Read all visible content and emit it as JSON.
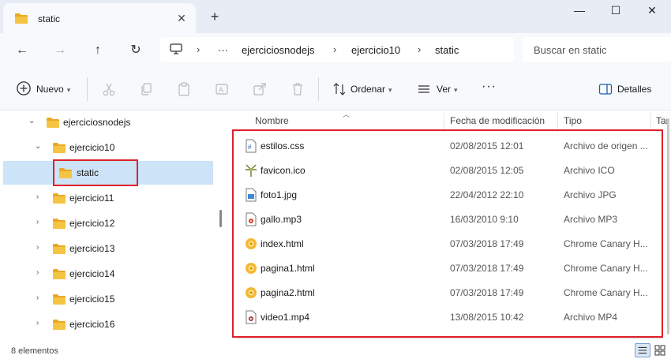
{
  "tab": {
    "title": "static",
    "close": "✕",
    "new": "+"
  },
  "window": {
    "minimize": "—",
    "maximize": "☐",
    "close": "✕"
  },
  "address": {
    "overflow": "···",
    "separator": "›",
    "crumbs": [
      "ejerciciosnodejs",
      "ejercicio10",
      "static"
    ],
    "search_placeholder": "Buscar en static"
  },
  "toolbar": {
    "new_label": "Nuevo",
    "sort_label": "Ordenar",
    "view_label": "Ver",
    "more_label": "···",
    "details_label": "Detalles"
  },
  "nav": {
    "items": [
      {
        "label": "ejerciciosnodejs",
        "expanded": true
      },
      {
        "label": "ejercicio10",
        "expanded": true
      },
      {
        "label": "static",
        "selected": true
      },
      {
        "label": "ejercicio11"
      },
      {
        "label": "ejercicio12"
      },
      {
        "label": "ejercicio13"
      },
      {
        "label": "ejercicio14"
      },
      {
        "label": "ejercicio15"
      },
      {
        "label": "ejercicio16"
      }
    ]
  },
  "columns": {
    "name": "Nombre",
    "date": "Fecha de modificación",
    "type": "Tipo",
    "size": "Tar"
  },
  "files": [
    {
      "name": "estilos.css",
      "date": "02/08/2015 12:01",
      "type": "Archivo de origen ...",
      "icon": "css-file-icon"
    },
    {
      "name": "favicon.ico",
      "date": "02/08/2015 12:05",
      "type": "Archivo ICO",
      "icon": "ico-file-icon"
    },
    {
      "name": "foto1.jpg",
      "date": "22/04/2012 22:10",
      "type": "Archivo JPG",
      "icon": "image-file-icon"
    },
    {
      "name": "gallo.mp3",
      "date": "16/03/2010 9:10",
      "type": "Archivo MP3",
      "icon": "audio-file-icon"
    },
    {
      "name": "index.html",
      "date": "07/03/2018 17:49",
      "type": "Chrome Canary H...",
      "icon": "chrome-canary-icon"
    },
    {
      "name": "pagina1.html",
      "date": "07/03/2018 17:49",
      "type": "Chrome Canary H...",
      "icon": "chrome-canary-icon"
    },
    {
      "name": "pagina2.html",
      "date": "07/03/2018 17:49",
      "type": "Chrome Canary H...",
      "icon": "chrome-canary-icon"
    },
    {
      "name": "video1.mp4",
      "date": "13/08/2015 10:42",
      "type": "Archivo MP4",
      "icon": "video-file-icon"
    }
  ],
  "status": {
    "count": "8 elementos"
  },
  "colors": {
    "folder": "#f6c443",
    "selection": "#cde3f7",
    "highlight": "#e0202a",
    "canary": "#f5b82e"
  }
}
